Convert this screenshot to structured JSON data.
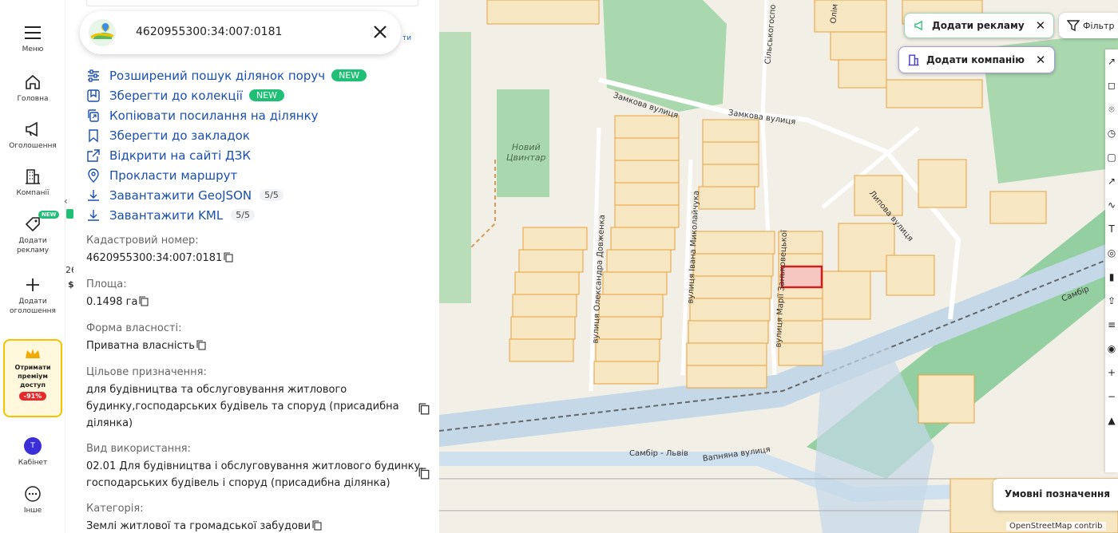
{
  "nav": {
    "menu": "Меню",
    "home": "Головна",
    "ads": "Оголошення",
    "companies": "Компанії",
    "add_ad": "Додати рекламу",
    "add_ad_badge": "NEW",
    "add_listing": "Додати оголошення",
    "premium_title": "Отримати преміум доступ",
    "premium_discount": "-91%",
    "cabinet_avatar": "Т",
    "cabinet": "Кабінет",
    "other": "Інше"
  },
  "edge": {
    "num": "26",
    "s": "$"
  },
  "search": {
    "cadastral": "4620955300:34:007:0181",
    "side_link": "ти"
  },
  "actions": [
    {
      "label": "Розширений пошук ділянок поруч",
      "badge": "NEW",
      "icon": "sliders-icon"
    },
    {
      "label": "Зберегти до колекції",
      "badge": "NEW",
      "icon": "collection-icon"
    },
    {
      "label": "Копіювати посилання на ділянку",
      "icon": "copy-link-icon"
    },
    {
      "label": "Зберегти до закладок",
      "icon": "bookmark-icon"
    },
    {
      "label": "Відкрити на сайті ДЗК",
      "icon": "external-link-icon"
    },
    {
      "label": "Прокласти маршрут",
      "icon": "location-pin-icon"
    },
    {
      "label": "Завантажити GeoJSON",
      "count": "5/5",
      "icon": "download-icon"
    },
    {
      "label": "Завантажити KML",
      "count": "5/5",
      "icon": "download-icon"
    }
  ],
  "fields": {
    "cadastral_label": "Кадастровий номер:",
    "cadastral_value": "4620955300:34:007:0181",
    "area_label": "Площа:",
    "area_value": "0.1498 га",
    "ownership_label": "Форма власності:",
    "ownership_value": "Приватна власність",
    "purpose_label": "Цільове призначення:",
    "purpose_l1": "для будівництва та обслуговування житлового",
    "purpose_l2": "будинку,господарських будівель та споруд (присадибна",
    "purpose_l3": "ділянка)",
    "usage_label": "Вид використання:",
    "usage_l1": "02.01 Для будівництва і обслуговування житлового будинку,",
    "usage_l2": "господарських будівель і споруд (присадибна ділянка)",
    "category_label": "Категорія:",
    "category_value": "Землі житлової та громадської забудови"
  },
  "map": {
    "add_ad": "Додати рекламу",
    "add_company": "Додати компанію",
    "filters": "Фільтр",
    "legend": "Умовні позначення",
    "attribution": "OpenStreetMap contrib",
    "labels": {
      "zamkova1": "Замкова вулиця",
      "zamkova2": "Замкова вулиця",
      "silska": "Сільськогоспо",
      "olimp": "Олім",
      "lypova": "Липова вулиця",
      "dovzhenka": "вулиця Олександра Довженка",
      "mykolaichuka": "вулиця Івана Миколайчука",
      "kotsiubynskoho": "вулиця Марії Заньковецької",
      "vapnyana": "Вапняна вулиця",
      "sambir_lviv": "Самбір - Львів",
      "sambir": "Самбір",
      "novyi": "Новий",
      "tsvyntar": "Цвинтар"
    }
  },
  "colors": {
    "link": "#1a4fb0",
    "new_green": "#1fbf75",
    "parcel_fill": "#f7e6c2",
    "parcel_stroke": "#e8a23a",
    "selected_parcel": "#cc1f1f",
    "green_area": "#a9d7ae",
    "railway_band": "#c4d8e8"
  }
}
